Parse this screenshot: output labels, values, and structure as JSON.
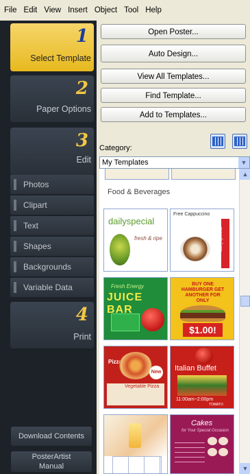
{
  "menu": [
    "File",
    "Edit",
    "View",
    "Insert",
    "Object",
    "Tool",
    "Help"
  ],
  "steps": [
    {
      "num": "1",
      "label": "Select Template"
    },
    {
      "num": "2",
      "label": "Paper Options"
    },
    {
      "num": "3",
      "label": "Edit"
    },
    {
      "num": "4",
      "label": "Print"
    }
  ],
  "edit_items": [
    "Photos",
    "Clipart",
    "Text",
    "Shapes",
    "Backgrounds",
    "Variable Data"
  ],
  "bottom": {
    "download": "Download Contents",
    "manual_line1": "PosterArtist",
    "manual_line2": "Manual"
  },
  "actions": {
    "open_poster": "Open Poster...",
    "auto_design": "Auto Design...",
    "view_all": "View All Templates...",
    "find": "Find Template...",
    "add": "Add to Templates..."
  },
  "category": {
    "label": "Category:",
    "selected": "My Templates"
  },
  "gallery": {
    "group": "Food & Beverages",
    "thumbs": [
      {
        "name": "dailyspecial-fresh",
        "title": "dailyspecial",
        "sub": "fresh & ripe"
      },
      {
        "name": "free-cappuccino",
        "title": "Free Cappuccino",
        "brand": "dailyspecial"
      },
      {
        "name": "juice-bar",
        "top": "Fresh Energy",
        "title": "JUICE BAR"
      },
      {
        "name": "burger-special",
        "top": "BUY ONE HAMBURGER GET ANOTHER FOR ONLY",
        "price": "$1.00!"
      },
      {
        "name": "pizza",
        "title": "Pizza",
        "badge": "New",
        "sub": "Vegetable Pizza"
      },
      {
        "name": "italian-buffet",
        "title": "Italian Buffet",
        "time": "11:00am~2:00pm",
        "brand": "TOMATO"
      },
      {
        "name": "drink",
        "title": ""
      },
      {
        "name": "cakes",
        "title": "Cakes",
        "sub": "for Your Special Occasion"
      }
    ]
  }
}
